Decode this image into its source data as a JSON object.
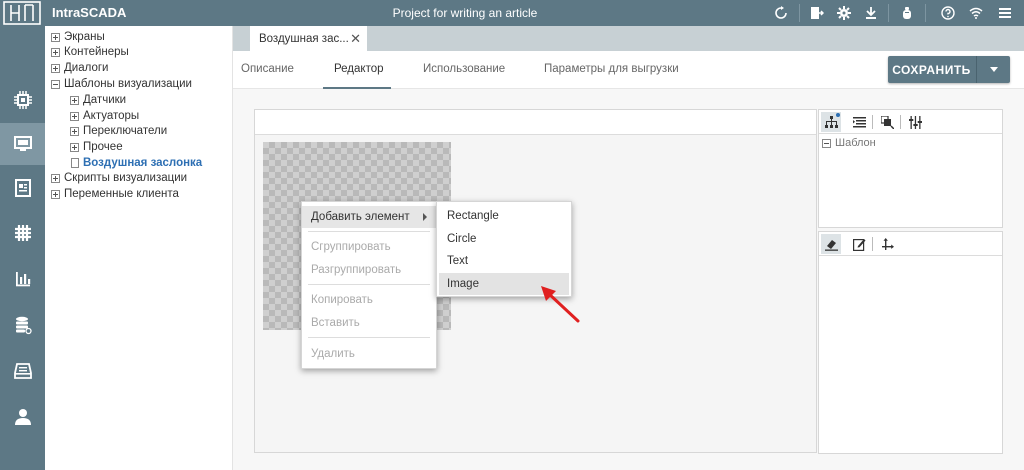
{
  "topbar": {
    "app_title": "IntraSCADA",
    "project_title": "Project for writing an article",
    "icons": [
      "refresh-icon",
      "export-icon",
      "gear-icon",
      "download-icon",
      "bug-icon",
      "help-icon",
      "wifi-icon",
      "menu-icon"
    ]
  },
  "rail": {
    "items": [
      "chip-icon",
      "monitor-icon",
      "report-icon",
      "grid-icon",
      "chart-icon",
      "database-icon",
      "archive-icon",
      "user-icon"
    ],
    "active": "monitor-icon"
  },
  "tree": {
    "items": [
      {
        "label": "Экраны",
        "expander": "plus"
      },
      {
        "label": "Контейнеры",
        "expander": "plus"
      },
      {
        "label": "Диалоги",
        "expander": "plus"
      },
      {
        "label": "Шаблоны визуализации",
        "expander": "minus"
      },
      {
        "label": "Датчики",
        "expander": "plus"
      },
      {
        "label": "Актуаторы",
        "expander": "plus"
      },
      {
        "label": "Переключатели",
        "expander": "plus"
      },
      {
        "label": "Прочее",
        "expander": "plus"
      },
      {
        "label": "Воздушная заслонка",
        "expander": "doc",
        "selected": true
      },
      {
        "label": "Скрипты визуализации",
        "expander": "plus"
      },
      {
        "label": "Переменные клиента",
        "expander": "plus"
      }
    ]
  },
  "doc_tab": {
    "label": "Воздушная зас...",
    "close": "✕"
  },
  "nav_tabs": [
    "Описание",
    "Редактор",
    "Использование",
    "Параметры для выгрузки"
  ],
  "save_button": {
    "label": "СОХРАНИТЬ"
  },
  "template_tree": {
    "label": "Шаблон"
  },
  "context_menu": {
    "add_element": "Добавить элемент",
    "group": "Сгруппировать",
    "ungroup": "Разгруппировать",
    "copy": "Копировать",
    "paste": "Вставить",
    "delete": "Удалить"
  },
  "submenu": {
    "items": [
      "Rectangle",
      "Circle",
      "Text",
      "Image"
    ],
    "hovered": "Image"
  },
  "colors": {
    "bar": "#5d7885",
    "accent": "#2d6fb3",
    "arrow": "#e02020"
  }
}
